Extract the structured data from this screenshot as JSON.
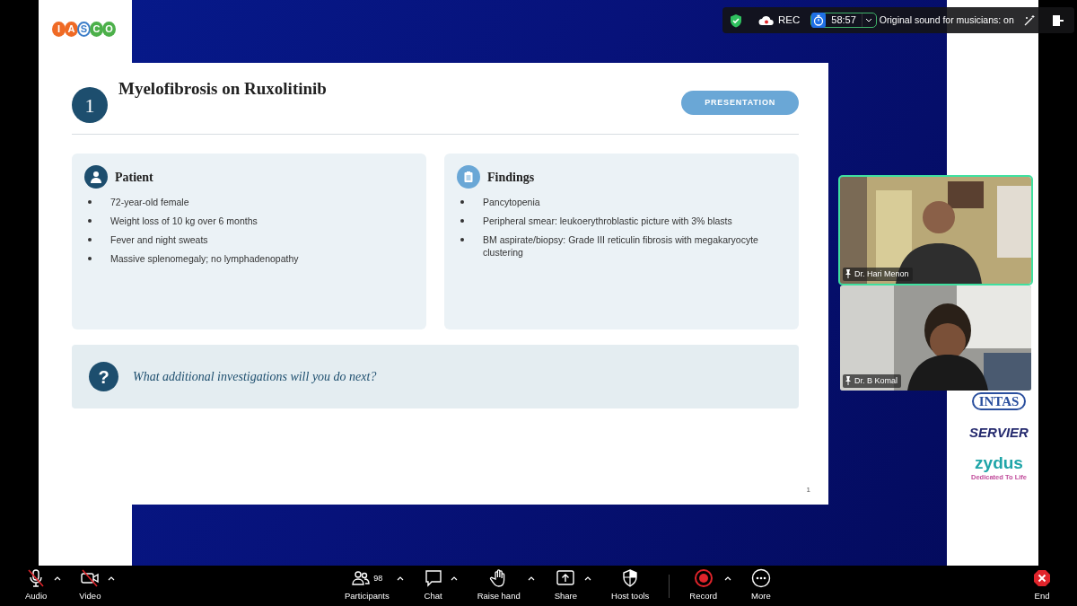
{
  "meeting_bar": {
    "rec_label": "REC",
    "timer": "58:57",
    "sound_status": "Original sound for musicians: on"
  },
  "left_logo": [
    {
      "letter": "I",
      "color": "#ef6a25"
    },
    {
      "letter": "A",
      "color": "#ef6a25"
    },
    {
      "letter": "S",
      "color": "#3d7ec9"
    },
    {
      "letter": "C",
      "color": "#4cb04a"
    },
    {
      "letter": "O",
      "color": "#4cb04a"
    }
  ],
  "slide": {
    "number": "1",
    "title": "Myelofibrosis on Ruxolitinib",
    "tag": "PRESENTATION",
    "panels": [
      {
        "kind": "patient",
        "title": "Patient",
        "items": [
          "72-year-old female",
          "Weight loss of 10 kg over 6 months",
          "Fever and night sweats",
          "Massive splenomegaly; no lymphadenopathy"
        ]
      },
      {
        "kind": "findings",
        "title": "Findings",
        "items": [
          "Pancytopenia",
          "Peripheral smear: leukoerythroblastic picture with 3% blasts",
          "BM aspirate/biopsy: Grade III reticulin fibrosis with megakaryocyte clustering"
        ]
      }
    ],
    "question_mark": "?",
    "question": "What additional investigations will you do next?",
    "page_number": "1"
  },
  "sponsors": [
    {
      "kind": "intas",
      "name": "INTAS"
    },
    {
      "kind": "servier",
      "name": "SERVIER"
    },
    {
      "kind": "zydus",
      "name": "zydus",
      "tagline": "Dedicated To Life"
    }
  ],
  "video_tiles": [
    {
      "name": "Dr. Hari Menon",
      "speaking": true
    },
    {
      "name": "Dr. B Komal",
      "speaking": false
    }
  ],
  "toolbar": [
    {
      "kind": "audio",
      "label": "Audio",
      "off": true,
      "caret": true
    },
    {
      "kind": "video",
      "label": "Video",
      "off": true,
      "caret": true
    },
    {
      "kind": "participants",
      "label": "Participants",
      "count": "98",
      "caret": true
    },
    {
      "kind": "chat",
      "label": "Chat",
      "caret": true
    },
    {
      "kind": "hand",
      "label": "Raise hand",
      "caret": true
    },
    {
      "kind": "share",
      "label": "Share",
      "caret": true
    },
    {
      "kind": "host",
      "label": "Host tools",
      "caret": false
    },
    {
      "kind": "record",
      "label": "Record",
      "caret": true
    },
    {
      "kind": "more",
      "label": "More",
      "caret": false
    },
    {
      "kind": "end",
      "label": "End",
      "caret": false
    }
  ]
}
